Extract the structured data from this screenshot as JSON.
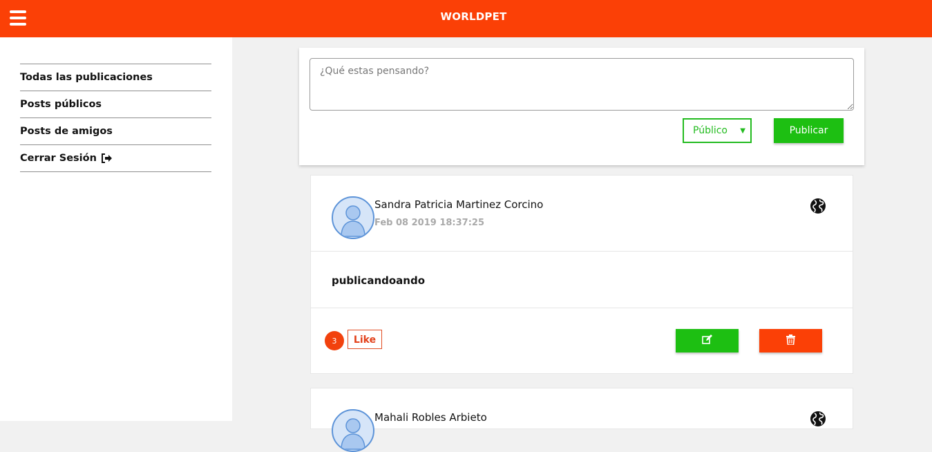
{
  "app": {
    "brand": "WORLDPET"
  },
  "sidebar": {
    "items": [
      {
        "label": "Todas las publicaciones"
      },
      {
        "label": "Posts públicos"
      },
      {
        "label": "Posts de amigos"
      },
      {
        "label": "Cerrar Sesión",
        "icon": "sign-out-icon"
      }
    ]
  },
  "composer": {
    "placeholder": "¿Qué estas pensando?",
    "privacy_selected": "Público",
    "publish_label": "Publicar"
  },
  "posts": [
    {
      "author": "Sandra Patricia Martinez Corcino",
      "timestamp": "Feb 08 2019 18:37:25",
      "visibility_icon": "globe-icon",
      "content": "publicandoando",
      "likes": "3",
      "like_label": "Like",
      "edit_icon": "edit-icon",
      "delete_icon": "trash-icon"
    },
    {
      "author": "Mahali Robles Arbieto",
      "visibility_icon": "globe-icon"
    }
  ],
  "colors": {
    "brand": "#fb4006",
    "accent_green": "#1dbf12",
    "background": "#f1f1f1"
  }
}
